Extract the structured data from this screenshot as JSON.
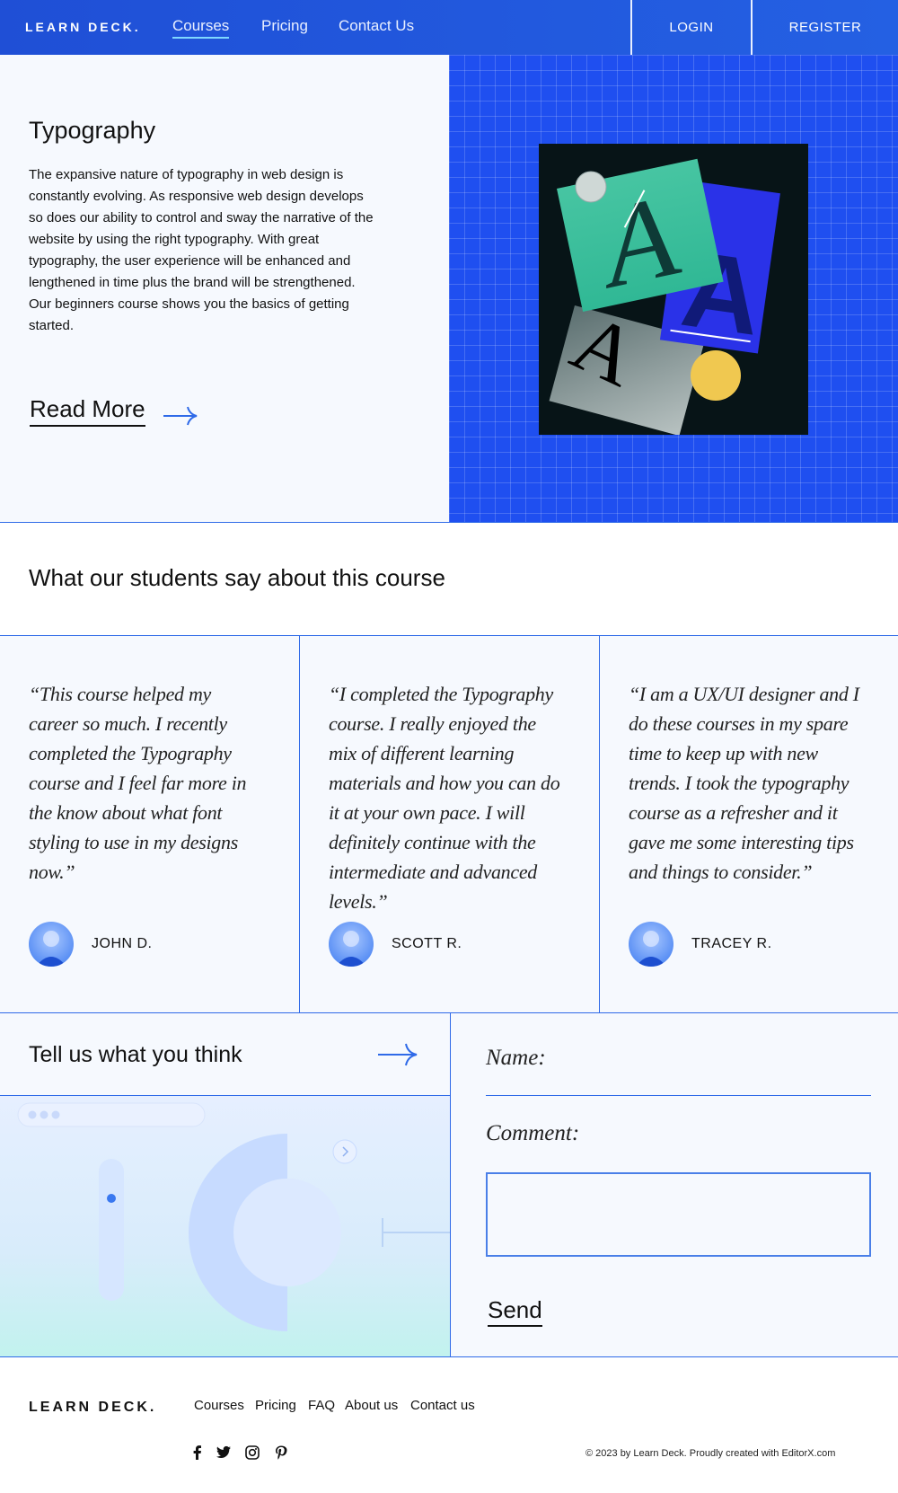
{
  "header": {
    "logo": "LEARN DECK.",
    "nav": [
      "Courses",
      "Pricing",
      "Contact Us"
    ],
    "login": "LOGIN",
    "register": "REGISTER"
  },
  "hero": {
    "title": "Typography",
    "text": "The expansive nature of typography in web design is constantly evolving. As responsive web design develops so does our ability to control and sway the narrative of the website by using the right typography.  With great typography, the user experience will be enhanced and lengthened in time plus the brand will be strengthened. Our beginners course shows you the basics of getting started.",
    "read_more": "Read More"
  },
  "testimonials": {
    "title": "What our students say about this course",
    "items": [
      {
        "quote": "“This course helped my career so much. I recently completed the Typography course and I feel far more in the know about what font styling to use in my designs now.”",
        "name": "JOHN D."
      },
      {
        "quote": "“I completed the Typography course. I really enjoyed the mix of different learning materials and how you can do it at your own pace. I will definitely continue with the intermediate and advanced levels.”",
        "name": "SCOTT R."
      },
      {
        "quote": "“I am a UX/UI designer and I do these courses in my spare time to keep up with new trends. I took the typography course as a refresher and it gave me some interesting tips and things to consider.”",
        "name": "TRACEY R."
      }
    ]
  },
  "feedback": {
    "title": "Tell us what you think",
    "name_label": "Name:",
    "comment_label": "Comment:",
    "send": "Send"
  },
  "footer": {
    "logo": "LEARN DECK.",
    "nav": [
      "Courses",
      "Pricing",
      "FAQ",
      "About us",
      "Contact us"
    ],
    "social_icons": [
      "facebook-icon",
      "twitter-icon",
      "instagram-icon",
      "pinterest-icon"
    ],
    "copyright": "© 2023 by Learn Deck. Proudly created with EditorX.com"
  },
  "colors": {
    "brand_blue": "#1f4ff0",
    "accent_line": "#2f6ae8",
    "light_bg": "#f6f9fe"
  }
}
